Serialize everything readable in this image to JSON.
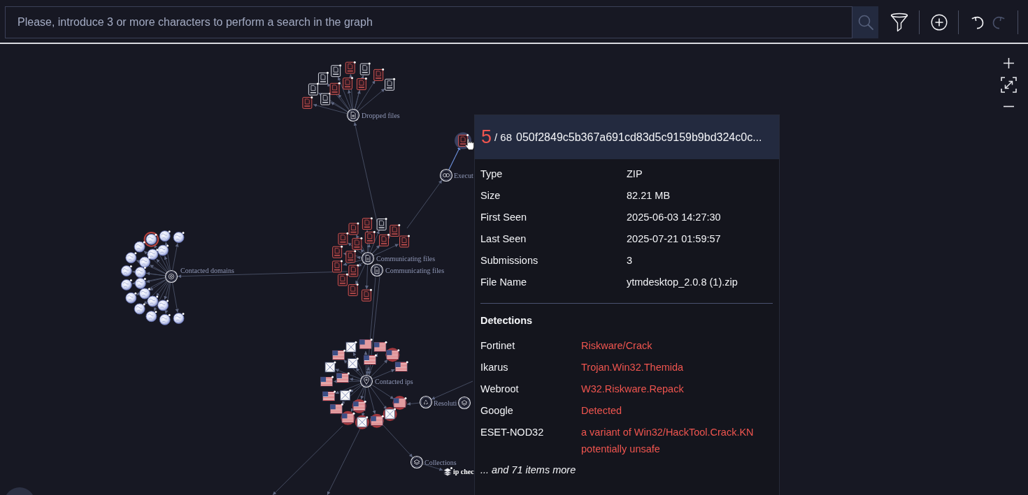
{
  "search": {
    "placeholder": "Please, introduce 3 or more characters to perform a search in the graph"
  },
  "toolbar": [
    {
      "kind": "filter",
      "disabled": false
    },
    {
      "kind": "add",
      "disabled": false
    },
    {
      "kind": "undo",
      "disabled": false
    },
    {
      "kind": "redo",
      "disabled": true
    }
  ],
  "zoom_controls": [
    {
      "kind": "zoom-in"
    },
    {
      "kind": "fit"
    },
    {
      "kind": "zoom-out"
    }
  ],
  "graph": {
    "groups": [
      {
        "label": "Dropped files",
        "kind": "dropped",
        "children": [
          {
            "kind": "file",
            "detected": true,
            "selected": false
          },
          {
            "kind": "file",
            "detected": false,
            "selected": false
          },
          {
            "kind": "file",
            "detected": false,
            "selected": false
          },
          {
            "kind": "file",
            "detected": false,
            "selected": false
          },
          {
            "kind": "file",
            "detected": true,
            "selected": false
          },
          {
            "kind": "file",
            "detected": false,
            "selected": false
          },
          {
            "kind": "file",
            "detected": true,
            "selected": false
          },
          {
            "kind": "file",
            "detected": false,
            "selected": false
          },
          {
            "kind": "file",
            "detected": false,
            "selected": false
          },
          {
            "kind": "file",
            "detected": true,
            "selected": false
          },
          {
            "kind": "file",
            "detected": true,
            "selected": false
          },
          {
            "kind": "file",
            "detected": true,
            "selected": false
          }
        ]
      },
      {
        "label": "Execut",
        "kind": "execution",
        "children": [
          {
            "kind": "file",
            "detected": true,
            "selected": true
          }
        ]
      },
      {
        "label": "Contacted domains",
        "kind": "domains",
        "children": [
          {
            "kind": "globe",
            "detected": false,
            "selected": false
          },
          {
            "kind": "globe",
            "detected": false,
            "selected": false
          },
          {
            "kind": "globe",
            "detected": true,
            "selected": false
          },
          {
            "kind": "globe",
            "detected": false,
            "selected": false
          },
          {
            "kind": "globe",
            "detected": false,
            "selected": false
          },
          {
            "kind": "globe",
            "detected": false,
            "selected": false
          },
          {
            "kind": "globe",
            "detected": false,
            "selected": false
          },
          {
            "kind": "globe",
            "detected": false,
            "selected": false
          },
          {
            "kind": "globe",
            "detected": false,
            "selected": false
          },
          {
            "kind": "globe",
            "detected": false,
            "selected": false
          },
          {
            "kind": "globe",
            "detected": false,
            "selected": false
          },
          {
            "kind": "globe",
            "detected": false,
            "selected": false
          },
          {
            "kind": "globe",
            "detected": false,
            "selected": false
          },
          {
            "kind": "globe",
            "detected": false,
            "selected": false
          },
          {
            "kind": "globe",
            "detected": false,
            "selected": false
          },
          {
            "kind": "globe",
            "detected": false,
            "selected": false
          },
          {
            "kind": "globe",
            "detected": false,
            "selected": false
          },
          {
            "kind": "globe",
            "detected": false,
            "selected": false
          },
          {
            "kind": "globe",
            "detected": false,
            "selected": false
          },
          {
            "kind": "globe",
            "detected": false,
            "selected": false
          }
        ]
      },
      {
        "label": "Communicating files",
        "kind": "files",
        "children": [
          {
            "kind": "file",
            "detected": true,
            "selected": false
          },
          {
            "kind": "file",
            "detected": true,
            "selected": false
          },
          {
            "kind": "file",
            "detected": true,
            "selected": false
          },
          {
            "kind": "file",
            "detected": true,
            "selected": false
          },
          {
            "kind": "file",
            "detected": true,
            "selected": false
          },
          {
            "kind": "file",
            "detected": true,
            "selected": false
          },
          {
            "kind": "file",
            "detected": true,
            "selected": false
          },
          {
            "kind": "file",
            "detected": true,
            "selected": false
          },
          {
            "kind": "file",
            "detected": false,
            "selected": false
          },
          {
            "kind": "file",
            "detected": true,
            "selected": false
          },
          {
            "kind": "file",
            "detected": true,
            "selected": false
          },
          {
            "kind": "file",
            "detected": true,
            "selected": false
          },
          {
            "kind": "file",
            "detected": true,
            "selected": false
          },
          {
            "kind": "file",
            "detected": true,
            "selected": false
          },
          {
            "kind": "file",
            "detected": true,
            "selected": false
          },
          {
            "kind": "file",
            "detected": true,
            "selected": false
          }
        ]
      },
      {
        "label": "Communicating files",
        "kind": "files"
      },
      {
        "label": "Contacted ips",
        "kind": "ips",
        "children": [
          {
            "kind": "flag",
            "detected": true,
            "selected": false
          },
          {
            "kind": "broken",
            "detected": true,
            "selected": false
          },
          {
            "kind": "flag",
            "detected": true,
            "selected": false
          },
          {
            "kind": "broken",
            "detected": true,
            "selected": false
          },
          {
            "kind": "flag",
            "detected": true,
            "selected": false
          },
          {
            "kind": "flag",
            "detected": false,
            "selected": false
          },
          {
            "kind": "flag",
            "detected": false,
            "selected": false
          },
          {
            "kind": "flag",
            "detected": false,
            "selected": false
          },
          {
            "kind": "broken",
            "detected": false,
            "selected": false
          },
          {
            "kind": "flag",
            "detected": false,
            "selected": false
          },
          {
            "kind": "broken",
            "detected": false,
            "selected": false
          },
          {
            "kind": "flag",
            "detected": false,
            "selected": false
          },
          {
            "kind": "flag",
            "detected": false,
            "selected": false
          },
          {
            "kind": "flag",
            "detected": true,
            "selected": false
          },
          {
            "kind": "flag",
            "detected": false,
            "selected": false
          },
          {
            "kind": "flag",
            "detected": true,
            "selected": false
          },
          {
            "kind": "broken",
            "detected": false,
            "selected": false
          },
          {
            "kind": "flag",
            "detected": false,
            "selected": false
          },
          {
            "kind": "broken",
            "detected": false,
            "selected": false
          },
          {
            "kind": "flag",
            "detected": false,
            "selected": false
          }
        ]
      },
      {
        "label": "Resoluti",
        "kind": "resolutions"
      },
      {
        "kind": "collection"
      },
      {
        "label": "Collections",
        "kind": "collection",
        "children": [
          {
            "kind": "collection",
            "label": "ip chec",
            "detected": false,
            "selected": false
          }
        ]
      }
    ]
  },
  "tooltip": {
    "score": "5",
    "total": "/ 68",
    "hash": "050f2849c5b367a691cd83d5c9159b9bd324c0c...",
    "fields": [
      {
        "label": "Type",
        "value": "ZIP"
      },
      {
        "label": "Size",
        "value": "82.21 MB"
      },
      {
        "label": "First Seen",
        "value": "2025-06-03 14:27:30"
      },
      {
        "label": "Last Seen",
        "value": "2025-07-21 01:59:57"
      },
      {
        "label": "Submissions",
        "value": "3"
      },
      {
        "label": "File Name",
        "value": "ytmdesktop_2.0.8 (1).zip"
      }
    ],
    "detections_title": "Detections",
    "detections": [
      {
        "engine": "Fortinet",
        "result": "Riskware/Crack"
      },
      {
        "engine": "Ikarus",
        "result": "Trojan.Win32.Themida"
      },
      {
        "engine": "Webroot",
        "result": "W32.Riskware.Repack"
      },
      {
        "engine": "Google",
        "result": "Detected"
      },
      {
        "engine": "ESET-NOD32",
        "result": "a variant of Win32/HackTool.Crack.KN potentially unsafe"
      }
    ],
    "more": "... and 71 items more"
  }
}
